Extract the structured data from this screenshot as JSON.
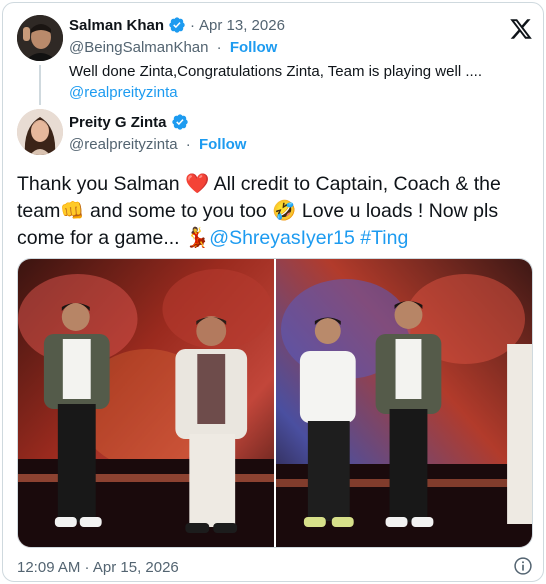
{
  "quoted_tweet": {
    "name": "Salman Khan",
    "date": "Apr 13, 2026",
    "handle": "@BeingSalmanKhan",
    "follow_label": "Follow",
    "text": "Well done Zinta,Congratulations Zinta, Team is playing well ....",
    "mention": "@realpreityzinta"
  },
  "tweet": {
    "name": "Preity G Zinta",
    "handle": "@realpreityzinta",
    "follow_label": "Follow",
    "text_part1": "Thank you Salman ",
    "heart": "❤️",
    "text_part2": " All credit to Captain, Coach & the team",
    "fist_emoji": "👊",
    "text_part3": " and some to you too ",
    "laugh_emoji": "🤣",
    "text_part4": " Love u loads ! Now pls come for a game... ",
    "dance_emoji": "💃",
    "mention": "@ShreyasIyer15",
    "hashtag": "#Ting",
    "timestamp": "12:09 AM · Apr 15, 2026"
  },
  "icons": {
    "x_logo": "x-logo-icon",
    "verified": "verified-badge-icon",
    "info": "info-icon"
  },
  "colors": {
    "accent": "#1d9bf0",
    "text": "#0f1419",
    "muted": "#536471",
    "border": "#cfd9de"
  }
}
